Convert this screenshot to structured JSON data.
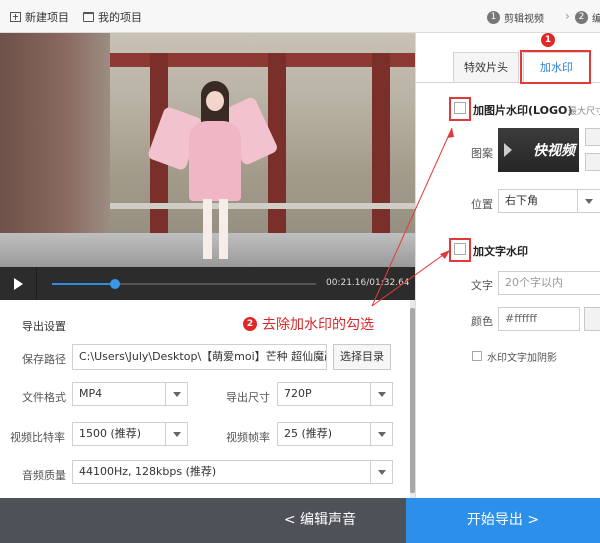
{
  "toolbar": {
    "new_project": "新建项目",
    "my_projects": "我的项目"
  },
  "steps": [
    {
      "num": "1",
      "label": "剪辑视频"
    },
    {
      "num": "2",
      "label": "编"
    }
  ],
  "player": {
    "timecode": "00:21.16/01:32.64",
    "progress": 0.24
  },
  "export": {
    "title": "导出设置",
    "save_path_label": "保存路径",
    "save_path_value": "C:\\Users\\July\\Desktop\\【萌爱moi】芒种 超仙魔改",
    "browse_button": "选择目录",
    "format_label": "文件格式",
    "format_value": "MP4",
    "size_label": "导出尺寸",
    "size_value": "720P",
    "bitrate_label": "视频比特率",
    "bitrate_value": "1500 (推荐)",
    "framerate_label": "视频帧率",
    "framerate_value": "25 (推荐)",
    "audio_label": "音频质量",
    "audio_value": "44100Hz, 128kbps (推荐)"
  },
  "right_panel": {
    "tab_effects": "特效片头",
    "tab_watermark": "加水印",
    "image_wm_title": "加图片水印(LOGO)",
    "image_wm_sub": "最大尺寸",
    "pattern_label": "图案",
    "logo_text": "快视频",
    "position_label": "位置",
    "position_value": "右下角",
    "text_wm_title": "加文字水印",
    "text_label": "文字",
    "text_placeholder": "20个字以内",
    "color_label": "颜色",
    "color_value": "#ffffff",
    "shadow_label": "水印文字加阴影"
  },
  "bottom": {
    "edit_audio": "< 编辑声音",
    "start_export": "开始导出 >"
  },
  "annotations": {
    "badge1": "1",
    "badge2": "2",
    "instruction": "去除加水印的勾选",
    "accent_color": "#e23a3a"
  }
}
